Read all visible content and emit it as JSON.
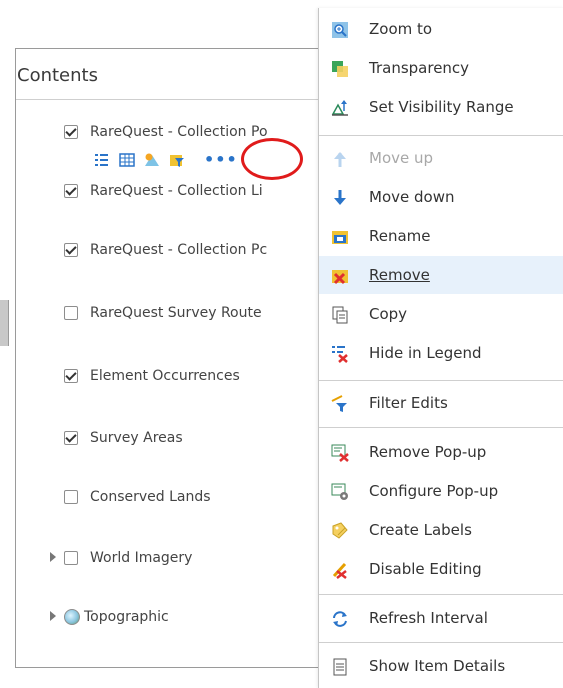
{
  "contents_panel": {
    "title": "Contents",
    "layers": [
      {
        "name": "RareQuest - Collection Po",
        "checked": true
      },
      {
        "name": "RareQuest - Collection Li",
        "checked": true
      },
      {
        "name": "RareQuest - Collection Pc",
        "checked": true
      },
      {
        "name": "RareQuest Survey Route",
        "checked": false
      },
      {
        "name": "Element Occurrences",
        "checked": true
      },
      {
        "name": "Survey Areas",
        "checked": true
      },
      {
        "name": "Conserved Lands",
        "checked": false
      },
      {
        "name": "World Imagery",
        "checked": false
      },
      {
        "name": "Topographic",
        "checked": false
      }
    ],
    "more_options_label": "•••"
  },
  "context_menu": {
    "items": [
      {
        "label": "Zoom to",
        "icon": "zoom-icon"
      },
      {
        "label": "Transparency",
        "icon": "transparency-icon"
      },
      {
        "label": "Set Visibility Range",
        "icon": "visibility-range-icon"
      },
      {
        "label": "Move up",
        "icon": "arrow-up-icon",
        "disabled": true
      },
      {
        "label": "Move down",
        "icon": "arrow-down-icon"
      },
      {
        "label": "Rename",
        "icon": "rename-icon"
      },
      {
        "label": "Remove",
        "icon": "remove-icon",
        "hovered": true
      },
      {
        "label": "Copy",
        "icon": "copy-icon"
      },
      {
        "label": "Hide in Legend",
        "icon": "hide-legend-icon"
      },
      {
        "label": "Filter Edits",
        "icon": "filter-edits-icon"
      },
      {
        "label": "Remove Pop-up",
        "icon": "remove-popup-icon"
      },
      {
        "label": "Configure Pop-up",
        "icon": "configure-popup-icon"
      },
      {
        "label": "Create Labels",
        "icon": "create-labels-icon"
      },
      {
        "label": "Disable Editing",
        "icon": "disable-editing-icon"
      },
      {
        "label": "Refresh Interval",
        "icon": "refresh-icon"
      },
      {
        "label": "Show Item Details",
        "icon": "item-details-icon"
      }
    ]
  },
  "colors": {
    "accent_blue": "#2a74c9",
    "highlight_ring": "#e01b1b",
    "hover_bg": "#e7f1fb"
  }
}
